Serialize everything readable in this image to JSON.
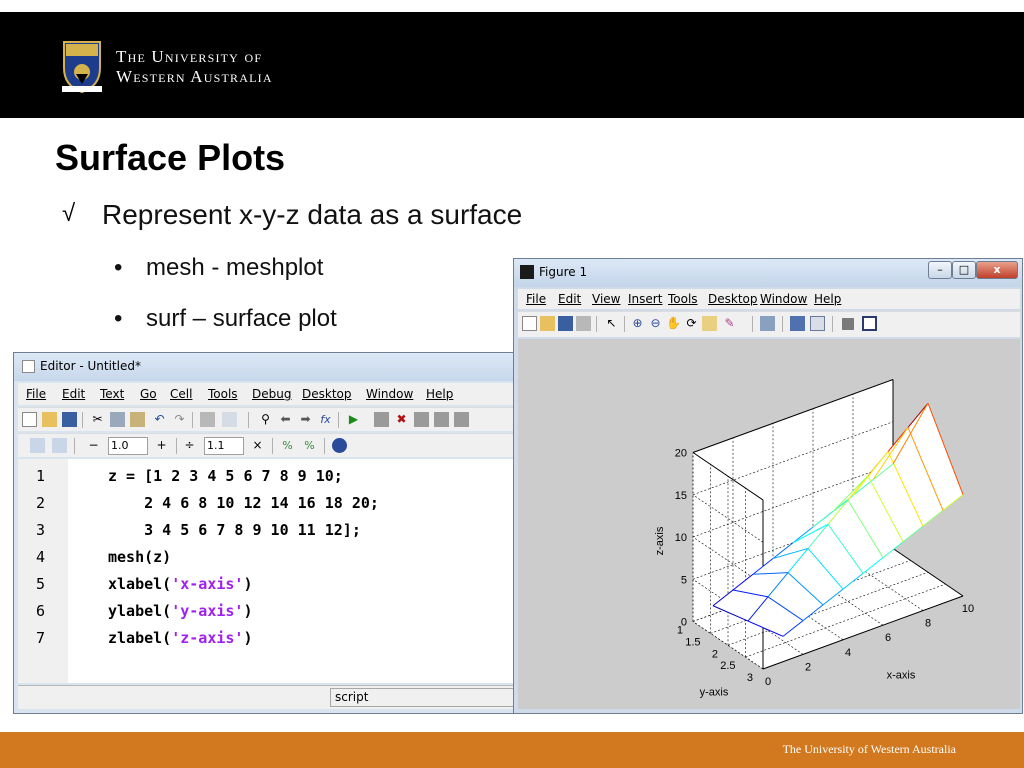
{
  "header": {
    "uni_line1": "The University of",
    "uni_line2": "Western Australia"
  },
  "slide": {
    "title": "Surface Plots",
    "check": "√",
    "bullet": "Represent x-y-z data as a surface",
    "sub_bullets": [
      {
        "dot": "•",
        "text": "mesh  - meshplot"
      },
      {
        "dot": "•",
        "text": "surf – surface plot"
      }
    ]
  },
  "footer": {
    "text": "The University of Western Australia"
  },
  "colors": {
    "footer": "#d2781e",
    "header": "#000000",
    "string_literal": "#a020f0"
  },
  "editor": {
    "title": "Editor - Untitled*",
    "menu": [
      "File",
      "Edit",
      "Text",
      "Go",
      "Cell",
      "Tools",
      "Debug",
      "Desktop",
      "Window",
      "Help"
    ],
    "toolbar2": {
      "minus": "−",
      "value1": "1.0",
      "plus": "+",
      "divide": "÷",
      "value2": "1.1",
      "times": "×"
    },
    "lines": [
      {
        "num": "1",
        "code": "z = [1 2 3 4 5 6 7 8 9 10;"
      },
      {
        "num": "2",
        "code": "    2 4 6 8 10 12 14 16 18 20;"
      },
      {
        "num": "3",
        "code": "    3 4 5 6 7 8 9 10 11 12];"
      },
      {
        "num": "4",
        "code": "mesh(z)"
      },
      {
        "num": "5",
        "pre": "xlabel(",
        "str": "'x-axis'",
        "post": ")"
      },
      {
        "num": "6",
        "pre": "ylabel(",
        "str": "'y-axis'",
        "post": ")"
      },
      {
        "num": "7",
        "pre": "zlabel(",
        "str": "'z-axis'",
        "post": ")"
      }
    ],
    "status": "script"
  },
  "figure": {
    "title": "Figure 1",
    "menu": [
      "File",
      "Edit",
      "View",
      "Insert",
      "Tools",
      "Desktop",
      "Window",
      "Help"
    ],
    "win_buttons": {
      "min": "–",
      "max": "□",
      "close": "x"
    }
  },
  "chart_data": {
    "type": "mesh",
    "z": [
      [
        1,
        2,
        3,
        4,
        5,
        6,
        7,
        8,
        9,
        10
      ],
      [
        2,
        4,
        6,
        8,
        10,
        12,
        14,
        16,
        18,
        20
      ],
      [
        3,
        4,
        5,
        6,
        7,
        8,
        9,
        10,
        11,
        12
      ]
    ],
    "x": [
      1,
      2,
      3,
      4,
      5,
      6,
      7,
      8,
      9,
      10
    ],
    "y": [
      1,
      2,
      3
    ],
    "xlabel": "x-axis",
    "ylabel": "y-axis",
    "zlabel": "z-axis",
    "xlim": [
      0,
      10
    ],
    "ylim": [
      1,
      3
    ],
    "zlim": [
      0,
      20
    ],
    "xticks": [
      "0",
      "2",
      "4",
      "6",
      "8",
      "10"
    ],
    "yticks": [
      "1",
      "1.5",
      "2",
      "2.5",
      "3"
    ],
    "zticks": [
      "0",
      "5",
      "10",
      "15",
      "20"
    ],
    "grid": true,
    "colormap": "jet"
  }
}
